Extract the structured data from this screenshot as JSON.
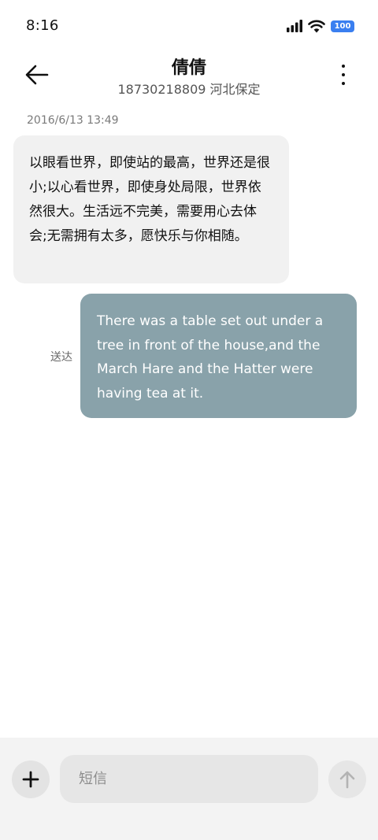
{
  "status_bar": {
    "time": "8:16",
    "battery": "100",
    "icons": [
      "signal-icon",
      "wifi-icon",
      "battery-icon"
    ]
  },
  "header": {
    "title": "倩倩",
    "subtitle": "18730218809 河北保定",
    "icons": [
      "back-arrow-icon",
      "more-vertical-icon"
    ]
  },
  "thread": {
    "timestamp": "2016/6/13 13:49",
    "messages": [
      {
        "direction": "incoming",
        "text": "以眼看世界，即使站的最高，世界还是很小;以心看世界，即使身处局限，世界依然很大。生活远不完美，需要用心去体会;无需拥有太多，愿快乐与你相随。"
      },
      {
        "direction": "outgoing",
        "status": "送达",
        "text": "There was a table set out under a tree in front of the house,and the March Hare and the Hatter were having tea at it."
      }
    ]
  },
  "composer": {
    "placeholder": "短信",
    "value": "",
    "icons": [
      "plus-icon",
      "send-arrow-up-icon"
    ]
  },
  "colors": {
    "outgoing_bubble": "#89a2aa",
    "incoming_bubble": "#f1f1f1",
    "battery_badge": "#3a7ff0"
  }
}
